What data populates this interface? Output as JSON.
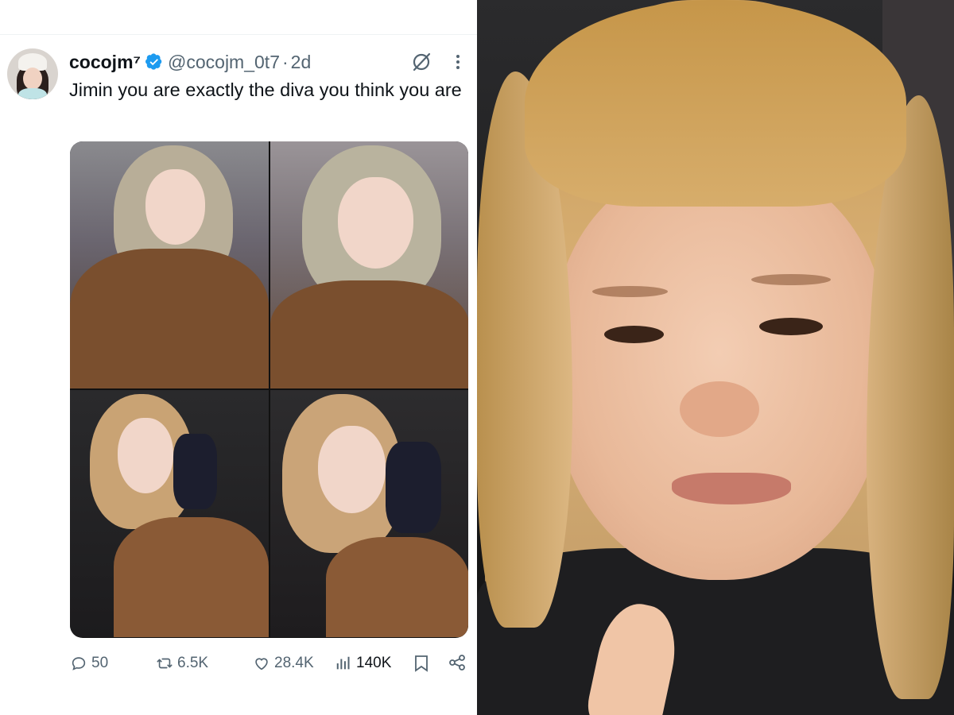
{
  "tweet": {
    "display_name": "cocojm⁷",
    "verified": true,
    "handle": "@cocojm_0t7",
    "separator": "·",
    "time": "2d",
    "text": "Jimin you are exactly the diva you think you are",
    "media_count": 4,
    "metrics": {
      "replies": "50",
      "reposts": "6.5K",
      "likes": "28.4K",
      "views": "140K"
    }
  },
  "icons": {
    "verified": "verified-badge-icon",
    "grok": "grok-icon",
    "more": "more-dots-icon",
    "reply": "reply-icon",
    "repost": "repost-icon",
    "like": "heart-icon",
    "views": "views-bar-chart-icon",
    "bookmark": "bookmark-icon",
    "share": "share-icon"
  },
  "colors": {
    "text_primary": "#0f1419",
    "text_secondary": "#536471",
    "verified_blue": "#1d9bf0",
    "divider": "#eff3f4"
  }
}
